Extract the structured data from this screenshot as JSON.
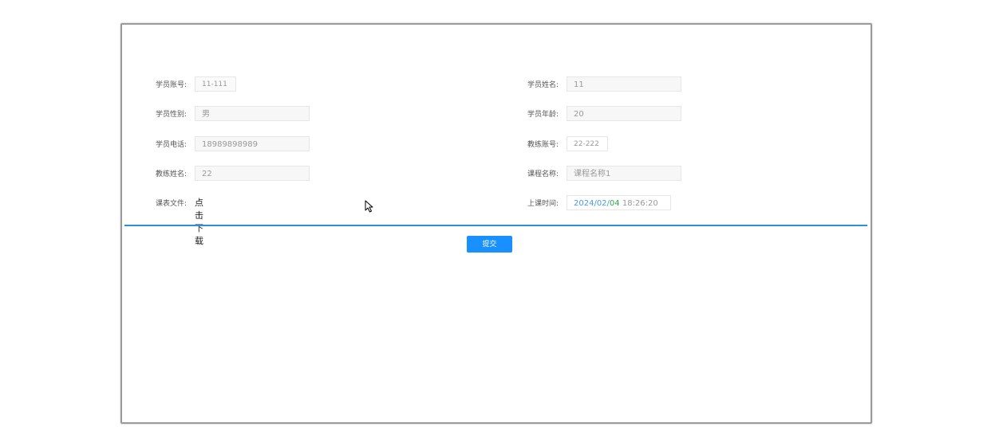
{
  "form": {
    "student_account": {
      "label": "学员账号:",
      "value": "11-111"
    },
    "student_name": {
      "label": "学员姓名:",
      "value": "11"
    },
    "student_gender": {
      "label": "学员性别:",
      "value": "男"
    },
    "student_age": {
      "label": "学员年龄:",
      "value": "20"
    },
    "student_phone": {
      "label": "学员电话:",
      "value": "18989898989"
    },
    "coach_account": {
      "label": "教练账号:",
      "value": "22-222"
    },
    "coach_name": {
      "label": "教练姓名:",
      "value": "22"
    },
    "course_name": {
      "label": "课程名称:",
      "value": "课程名称1"
    },
    "schedule_file": {
      "label": "课表文件:",
      "link": "点击下载"
    },
    "class_time": {
      "label": "上课时间:",
      "year_month": "2024/02/",
      "day": "04",
      "time": " 18:26:20"
    }
  },
  "actions": {
    "submit_label": "提交"
  },
  "colors": {
    "accent": "#1890ff",
    "divider": "#2b8fdd",
    "date_year": "#4a9ae8",
    "date_day": "#2aa84a"
  },
  "icons": {
    "cursor": "mouse-pointer-icon"
  }
}
